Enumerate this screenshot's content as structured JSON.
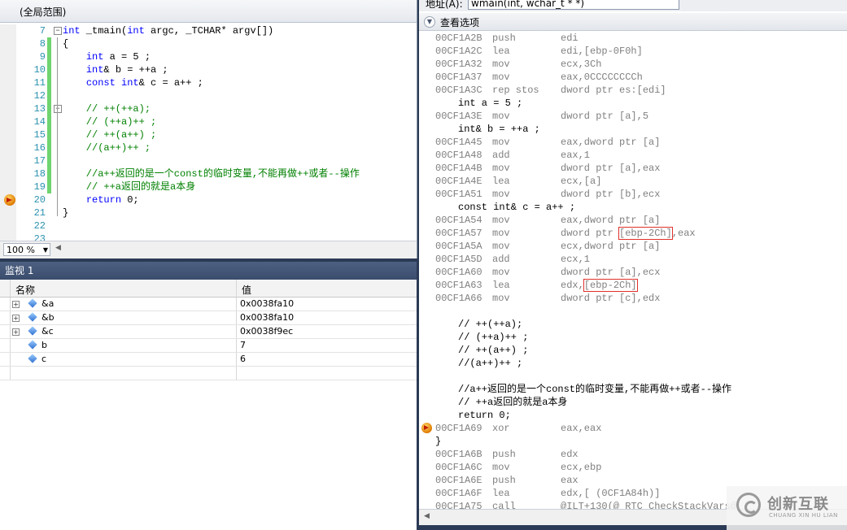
{
  "editor": {
    "scope": "(全局范围)",
    "zoom": "100 %",
    "lines": [
      {
        "num": "7",
        "text": "int _tmain(int argc, _TCHAR* argv[])",
        "fold": true,
        "bar": false
      },
      {
        "num": "8",
        "text": "{",
        "fold": false,
        "bar": true
      },
      {
        "num": "9",
        "text": "    int a = 5 ;",
        "fold": false,
        "bar": true
      },
      {
        "num": "10",
        "text": "    int& b = ++a ;",
        "fold": false,
        "bar": true
      },
      {
        "num": "11",
        "text": "    const int& c = a++ ;",
        "fold": false,
        "bar": true
      },
      {
        "num": "12",
        "text": "",
        "fold": false,
        "bar": true
      },
      {
        "num": "13",
        "text": "    // ++(++a);",
        "fold": true,
        "bar": true
      },
      {
        "num": "14",
        "text": "    // (++a)++ ;",
        "fold": false,
        "bar": true
      },
      {
        "num": "15",
        "text": "    // ++(a++) ;",
        "fold": false,
        "bar": true
      },
      {
        "num": "16",
        "text": "    //(a++)++ ;",
        "fold": false,
        "bar": true
      },
      {
        "num": "17",
        "text": "",
        "fold": false,
        "bar": true
      },
      {
        "num": "18",
        "text": "    //a++返回的是一个const的临时变量,不能再做++或者--操作",
        "fold": false,
        "bar": true
      },
      {
        "num": "19",
        "text": "    // ++a返回的就是a本身",
        "fold": false,
        "bar": true
      },
      {
        "num": "20",
        "text": "    return 0;",
        "fold": false,
        "bar": false,
        "current": true
      },
      {
        "num": "21",
        "text": "}",
        "fold": false,
        "bar": false
      },
      {
        "num": "22",
        "text": "",
        "fold": false,
        "bar": false
      },
      {
        "num": "23",
        "text": "",
        "fold": false,
        "bar": false
      }
    ]
  },
  "watch": {
    "title": "监视 1",
    "col_name": "名称",
    "col_value": "值",
    "rows": [
      {
        "name": "&a",
        "value": "0x0038fa10",
        "expandable": true
      },
      {
        "name": "&b",
        "value": "0x0038fa10",
        "expandable": true
      },
      {
        "name": "&c",
        "value": "0x0038f9ec",
        "expandable": true
      },
      {
        "name": "b",
        "value": "7",
        "expandable": false
      },
      {
        "name": "c",
        "value": "6",
        "expandable": false
      }
    ]
  },
  "disasm": {
    "address_label": "地址(A):",
    "address_value": "wmain(int, wchar_t * *)",
    "view_options": "查看选项",
    "lines": [
      {
        "kind": "asm",
        "addr": "00CF1A2B",
        "mn": "push",
        "op": "edi"
      },
      {
        "kind": "asm",
        "addr": "00CF1A2C",
        "mn": "lea",
        "op": "edi,[ebp-0F0h]"
      },
      {
        "kind": "asm",
        "addr": "00CF1A32",
        "mn": "mov",
        "op": "ecx,3Ch"
      },
      {
        "kind": "asm",
        "addr": "00CF1A37",
        "mn": "mov",
        "op": "eax,0CCCCCCCCh"
      },
      {
        "kind": "asm",
        "addr": "00CF1A3C",
        "mn": "rep stos",
        "op": "dword ptr es:[edi]"
      },
      {
        "kind": "src",
        "text": "int a = 5 ;"
      },
      {
        "kind": "asm",
        "addr": "00CF1A3E",
        "mn": "mov",
        "op": "dword ptr [a],5"
      },
      {
        "kind": "src",
        "text": "int& b = ++a ;"
      },
      {
        "kind": "asm",
        "addr": "00CF1A45",
        "mn": "mov",
        "op": "eax,dword ptr [a]"
      },
      {
        "kind": "asm",
        "addr": "00CF1A48",
        "mn": "add",
        "op": "eax,1"
      },
      {
        "kind": "asm",
        "addr": "00CF1A4B",
        "mn": "mov",
        "op": "dword ptr [a],eax"
      },
      {
        "kind": "asm",
        "addr": "00CF1A4E",
        "mn": "lea",
        "op": "ecx,[a]"
      },
      {
        "kind": "asm",
        "addr": "00CF1A51",
        "mn": "mov",
        "op": "dword ptr [b],ecx"
      },
      {
        "kind": "src",
        "text": "const int& c = a++ ;"
      },
      {
        "kind": "asm",
        "addr": "00CF1A54",
        "mn": "mov",
        "op": "eax,dword ptr [a]"
      },
      {
        "kind": "asm",
        "addr": "00CF1A57",
        "mn": "mov",
        "op_pre": "dword ptr ",
        "op_hl": "[ebp-2Ch]",
        "op_post": ",eax"
      },
      {
        "kind": "asm",
        "addr": "00CF1A5A",
        "mn": "mov",
        "op": "ecx,dword ptr [a]"
      },
      {
        "kind": "asm",
        "addr": "00CF1A5D",
        "mn": "add",
        "op": "ecx,1"
      },
      {
        "kind": "asm",
        "addr": "00CF1A60",
        "mn": "mov",
        "op": "dword ptr [a],ecx"
      },
      {
        "kind": "asm",
        "addr": "00CF1A63",
        "mn": "lea",
        "op_pre": "edx,",
        "op_hl": "[ebp-2Ch]",
        "op_post": ""
      },
      {
        "kind": "asm",
        "addr": "00CF1A66",
        "mn": "mov",
        "op": "dword ptr [c],edx"
      },
      {
        "kind": "blank"
      },
      {
        "kind": "src",
        "text": "// ++(++a);"
      },
      {
        "kind": "src",
        "text": "// (++a)++ ;"
      },
      {
        "kind": "src",
        "text": "// ++(a++) ;"
      },
      {
        "kind": "src",
        "text": "//(a++)++ ;"
      },
      {
        "kind": "blank"
      },
      {
        "kind": "src",
        "text": "//a++返回的是一个const的临时变量,不能再做++或者--操作"
      },
      {
        "kind": "src",
        "text": "// ++a返回的就是a本身"
      },
      {
        "kind": "src",
        "text": "return 0;"
      },
      {
        "kind": "asm",
        "addr": "00CF1A69",
        "mn": "xor",
        "op": "eax,eax",
        "current": true
      },
      {
        "kind": "src0",
        "text": "}"
      },
      {
        "kind": "asm",
        "addr": "00CF1A6B",
        "mn": "push",
        "op": "edx"
      },
      {
        "kind": "asm",
        "addr": "00CF1A6C",
        "mn": "mov",
        "op": "ecx,ebp"
      },
      {
        "kind": "asm",
        "addr": "00CF1A6E",
        "mn": "push",
        "op": "eax"
      },
      {
        "kind": "asm",
        "addr": "00CF1A6F",
        "mn": "lea",
        "op": "edx,[ (0CF1A84h)]"
      },
      {
        "kind": "asm",
        "addr": "00CF1A75",
        "mn": "call",
        "op": "@ILT+130(@_RTC_CheckStackVars@"
      }
    ]
  },
  "watermark": {
    "cn": "创新互联",
    "en": "CHUANG XIN HU LIAN"
  }
}
